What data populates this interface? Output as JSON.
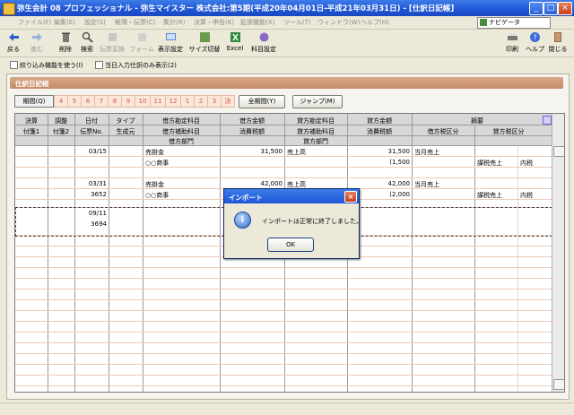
{
  "window": {
    "title": "弥生会計 08 プロフェッショナル - 弥生マイスター 株式会社:第5期(平成20年04月01日-平成21年03月31日) - [仕訳日記帳]",
    "buttons": {
      "minimize": "_",
      "maximize": "□",
      "close": "×"
    }
  },
  "menu": [
    "ファイル(F)",
    "編集(E)",
    "設定(S)",
    "帳簿・伝票(C)",
    "集計(R)",
    "決算・申告(K)",
    "拡張機能(X)",
    "ツール(T)",
    "ウィンドウ(W)",
    "ヘルプ(H)"
  ],
  "navigator": {
    "label": "ナビゲータ"
  },
  "toolbar": {
    "items": [
      "戻る",
      "進む",
      "削除",
      "検索",
      "伝票変換",
      "フォーム",
      "表示設定",
      "サイズ切替",
      "Excel",
      "科目設定"
    ],
    "right": [
      "印刷",
      "ヘルプ",
      "閉じる"
    ]
  },
  "options": {
    "filter": "絞り込み機能を使う(I)",
    "today": "当日入力仕訳のみ表示(2)"
  },
  "section": {
    "title": "仕訳日記帳"
  },
  "period": {
    "label": "期間(Q)",
    "months": [
      "4",
      "5",
      "6",
      "7",
      "8",
      "9",
      "10",
      "11",
      "12",
      "1",
      "2",
      "3",
      "決"
    ],
    "all_button": "全期間(Y)",
    "jump_button": "ジャンプ(M)"
  },
  "grid": {
    "header_row1": [
      "決算",
      "調整",
      "日付",
      "タイプ",
      "借方勘定科目",
      "借方金額",
      "貸方勘定科目",
      "貸方金額",
      "摘要"
    ],
    "header_row2": [
      "付箋1",
      "付箋2",
      "伝票No.",
      "生成元",
      "借方補助科目",
      "消費税額",
      "貸方補助科目",
      "消費税額",
      "借方税区分",
      "貸方税区分"
    ],
    "header_row3": [
      "借方部門",
      "貸方部門"
    ],
    "entries": [
      {
        "date": "03/15",
        "no": "",
        "debit_account": "売掛金",
        "debit_sub": "○○商事",
        "debit_amount": "31,500",
        "credit_account": "売上高",
        "credit_amount": "31,500",
        "credit_tax": "(1,500",
        "memo": "当月売上",
        "credit_tax_class": "課税売上",
        "tax_mode": "内税"
      },
      {
        "date": "03/31",
        "no": "3652",
        "debit_account": "売掛金",
        "debit_sub": "○○商事",
        "debit_amount": "42,000",
        "credit_account": "売上高",
        "credit_amount": "42,000",
        "credit_tax": "(2,000",
        "memo": "当月売上",
        "credit_tax_class": "課税売上",
        "tax_mode": "内税"
      },
      {
        "date": "09/11",
        "no": "3694"
      }
    ]
  },
  "dialog": {
    "title": "インポート",
    "message": "インポートは正常に終了しました。",
    "ok": "OK"
  }
}
